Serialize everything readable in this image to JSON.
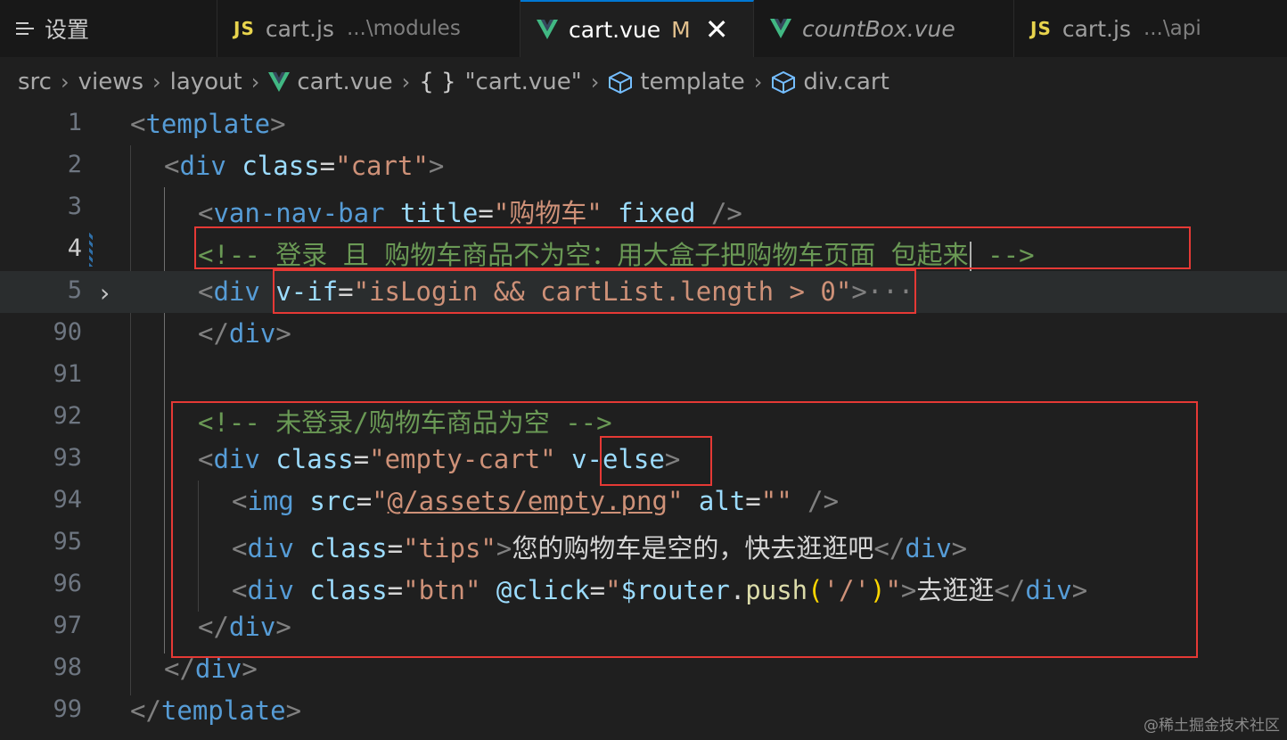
{
  "tabs": [
    {
      "icon": "settings-lines-icon",
      "label": "设置",
      "sub": ""
    },
    {
      "icon": "js-file-icon",
      "icon_text": "JS",
      "label": "cart.js",
      "sub": "...\\modules"
    },
    {
      "icon": "vue-file-icon",
      "label": "cart.vue",
      "modified": "M",
      "close": "✕"
    },
    {
      "icon": "vue-file-icon",
      "label": "countBox.vue",
      "sub": ""
    },
    {
      "icon": "js-file-icon",
      "icon_text": "JS",
      "label": "cart.js",
      "sub": "...\\api"
    }
  ],
  "breadcrumb": [
    "src",
    "views",
    "layout",
    "cart.vue",
    "\"cart.vue\"",
    "template",
    "div.cart"
  ],
  "breadcrumb_obj_icon": "{ }",
  "line_numbers": [
    "1",
    "2",
    "3",
    "4",
    "5",
    "90",
    "91",
    "92",
    "93",
    "94",
    "95",
    "96",
    "97",
    "98",
    "99"
  ],
  "code": {
    "l1": [
      "<",
      "template",
      ">"
    ],
    "l2": [
      "<",
      "div",
      "class",
      "=",
      "\"cart\"",
      ">"
    ],
    "l3": [
      "<",
      "van-nav-bar",
      "title",
      "=",
      "\"购物车\"",
      "fixed",
      "/>"
    ],
    "l4": [
      "<!-- 登录 且 购物车商品不为空：用大盒子把购物车页面 包起来",
      " -->"
    ],
    "l5": [
      "<",
      "div",
      "v-if",
      "=",
      "\"isLogin && cartList.length > 0\"",
      ">",
      "···"
    ],
    "l90": [
      "</",
      "div",
      ">"
    ],
    "l92": [
      "<!-- 未登录/购物车商品为空 -->"
    ],
    "l93": [
      "<",
      "div",
      "class",
      "=",
      "\"empty-cart\"",
      "v-else",
      ">"
    ],
    "l94": [
      "<",
      "img",
      "src",
      "=",
      "\"",
      "@/assets/empty.png",
      "\"",
      "alt",
      "=",
      "\"\"",
      "/>"
    ],
    "l95": [
      "<",
      "div",
      "class",
      "=",
      "\"tips\"",
      ">",
      "您的购物车是空的，快去逛逛吧",
      "</",
      "div",
      ">"
    ],
    "l96": [
      "<",
      "div",
      "class",
      "=",
      "\"btn\"",
      "@click",
      "=",
      "\"",
      "$router",
      ".",
      "push",
      "(",
      "'/'",
      ")",
      "\"",
      ">",
      "去逛逛",
      "</",
      "div",
      ">"
    ],
    "l97": [
      "</",
      "div",
      ">"
    ],
    "l98": [
      "</",
      "div",
      ">"
    ],
    "l99": [
      "</",
      "template",
      ">"
    ]
  },
  "fold_chevron": "›",
  "watermark": "@稀土掘金技术社区",
  "colors": {
    "background": "#1f1f1f",
    "tag": "#569cd6",
    "attribute": "#9cdcfe",
    "string": "#ce9178",
    "comment": "#6a9955",
    "highlight_box": "#e53935",
    "vue_green": "#41b883",
    "js_yellow": "#e8d44d"
  }
}
